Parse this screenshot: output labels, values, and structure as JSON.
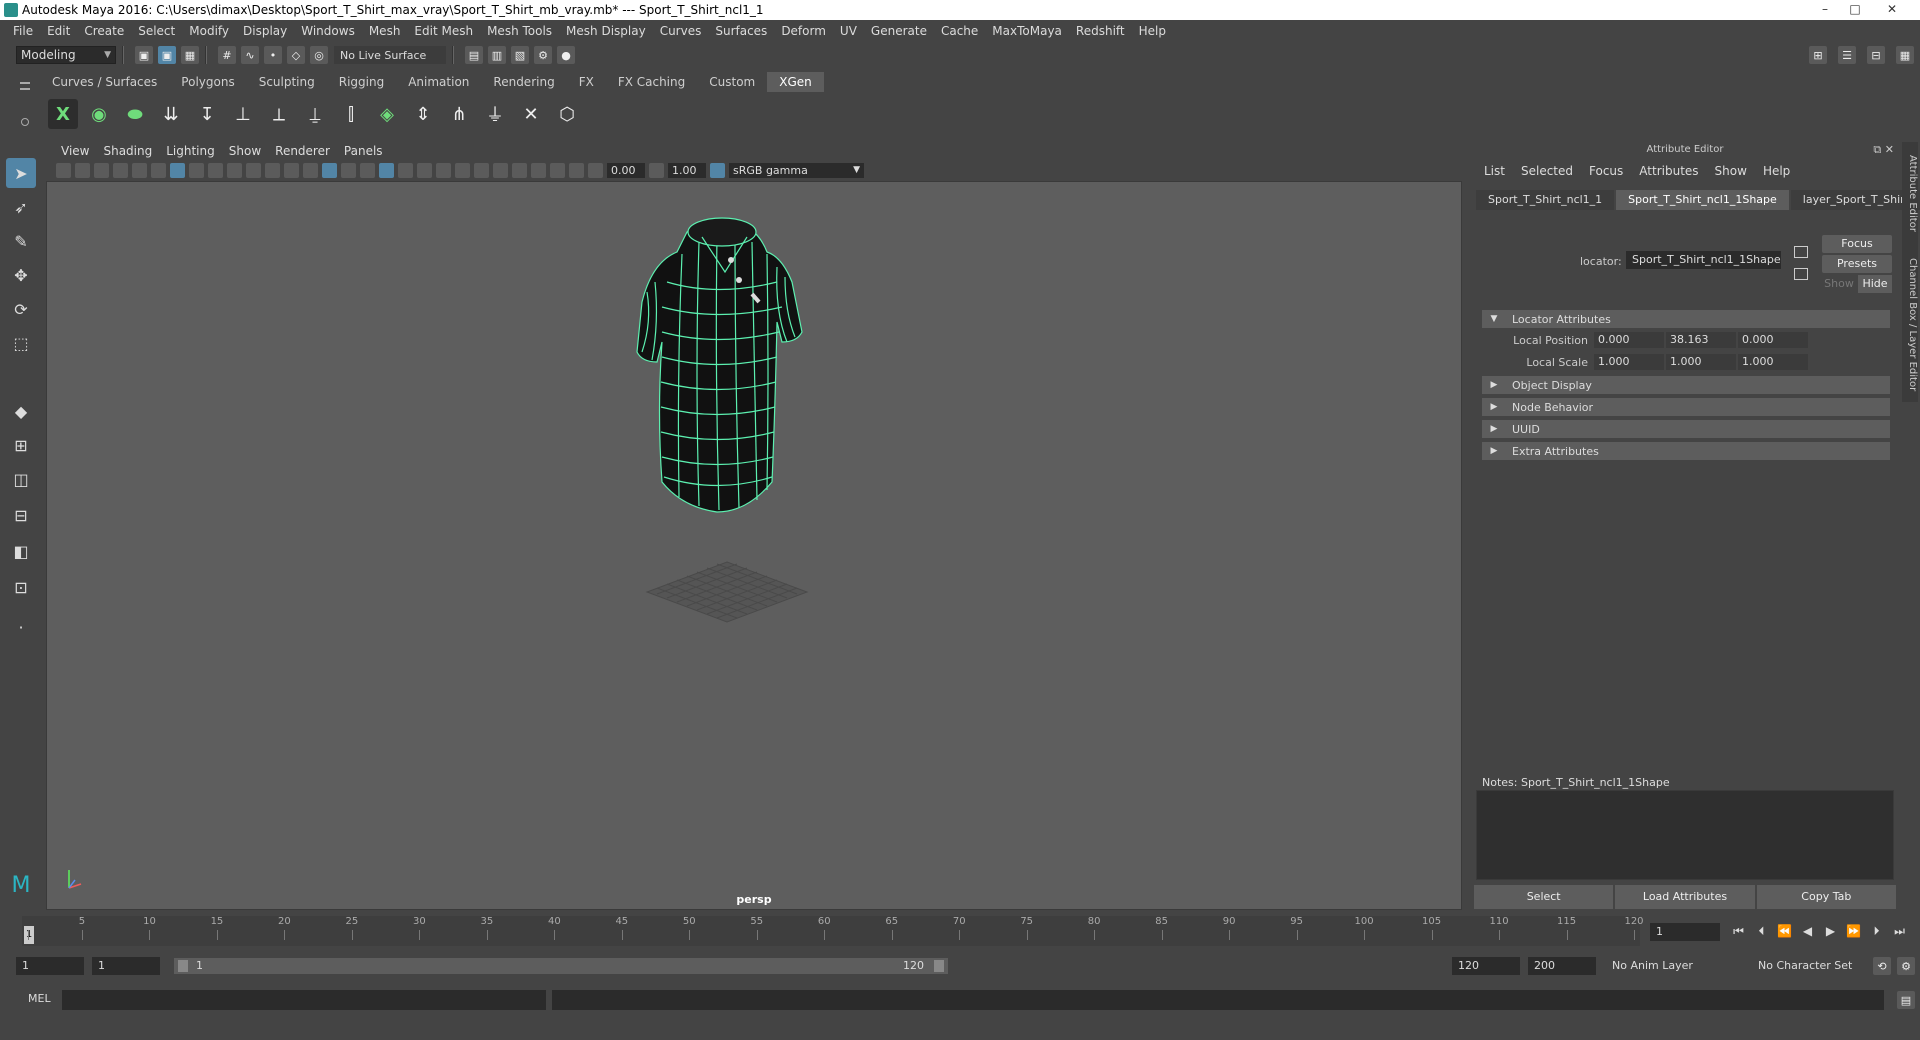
{
  "window": {
    "title": "Autodesk Maya 2016: C:\\Users\\dimax\\Desktop\\Sport_T_Shirt_max_vray\\Sport_T_Shirt_mb_vray.mb*   ---   Sport_T_Shirt_ncl1_1",
    "minimize": "–",
    "maximize": "□",
    "close": "✕"
  },
  "menus": [
    "File",
    "Edit",
    "Create",
    "Select",
    "Modify",
    "Display",
    "Windows",
    "Mesh",
    "Edit Mesh",
    "Mesh Tools",
    "Mesh Display",
    "Curves",
    "Surfaces",
    "Deform",
    "UV",
    "Generate",
    "Cache",
    "MaxToMaya",
    "Redshift",
    "Help"
  ],
  "status": {
    "mode": "Modeling",
    "live_surface": "No Live Surface"
  },
  "shelf": {
    "tabs": [
      "Curves / Surfaces",
      "Polygons",
      "Sculpting",
      "Rigging",
      "Animation",
      "Rendering",
      "FX",
      "FX Caching",
      "Custom",
      "XGen"
    ],
    "active_tab": "XGen"
  },
  "panel": {
    "menus": [
      "View",
      "Shading",
      "Lighting",
      "Show",
      "Renderer",
      "Panels"
    ],
    "exposure": "0.00",
    "gamma_value": "1.00",
    "color_space": "sRGB gamma",
    "camera": "persp"
  },
  "attribute_editor": {
    "header": "Attribute Editor",
    "menus": [
      "List",
      "Selected",
      "Focus",
      "Attributes",
      "Show",
      "Help"
    ],
    "tabs": [
      "Sport_T_Shirt_ncl1_1",
      "Sport_T_Shirt_ncl1_1Shape",
      "layer_Sport_T_Shirt"
    ],
    "active_tab": "Sport_T_Shirt_ncl1_1Shape",
    "locator_label": "locator:",
    "locator_value": "Sport_T_Shirt_ncl1_1Shape",
    "focus_btn": "Focus",
    "presets_btn": "Presets",
    "show_btn": "Show",
    "hide_btn": "Hide",
    "sections": [
      "Locator Attributes",
      "Object Display",
      "Node Behavior",
      "UUID",
      "Extra Attributes"
    ],
    "local_position_label": "Local Position",
    "local_position": [
      "0.000",
      "38.163",
      "0.000"
    ],
    "local_scale_label": "Local Scale",
    "local_scale": [
      "1.000",
      "1.000",
      "1.000"
    ],
    "notes_label": "Notes:  Sport_T_Shirt_ncl1_1Shape",
    "bottom_buttons": [
      "Select",
      "Load Attributes",
      "Copy Tab"
    ],
    "side_tabs": [
      "Attribute Editor",
      "Channel Box / Layer Editor"
    ]
  },
  "timeline": {
    "ticks": [
      "1",
      "5",
      "10",
      "15",
      "20",
      "25",
      "30",
      "35",
      "40",
      "45",
      "50",
      "55",
      "60",
      "65",
      "70",
      "75",
      "80",
      "85",
      "90",
      "95",
      "100",
      "105",
      "110",
      "115",
      "120"
    ],
    "current_frame": "1",
    "current_frame_field": "1"
  },
  "range": {
    "start_time": "1",
    "playback_start": "1",
    "range_start_label": "1",
    "range_end_label": "120",
    "playback_end": "120",
    "end_time": "200",
    "anim_layer": "No Anim Layer",
    "character_set": "No Character Set"
  },
  "command": {
    "label": "MEL"
  },
  "colors": {
    "wireframe": "#5cf0b0",
    "active_blue": "#5285a6"
  }
}
